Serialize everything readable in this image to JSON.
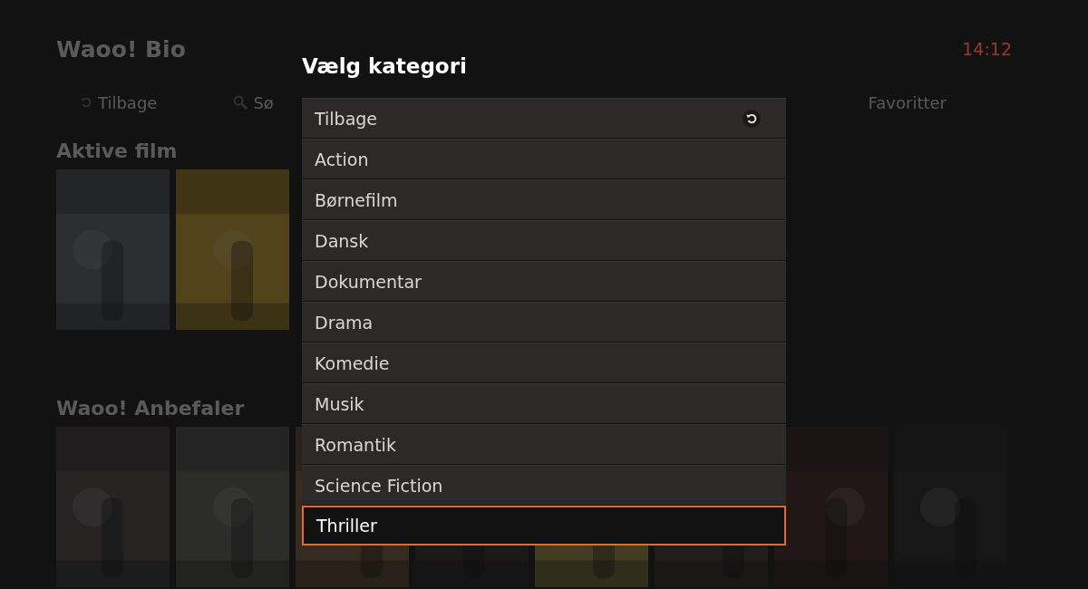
{
  "background": {
    "title": "Waoo! Bio",
    "clock": "14:12",
    "nav": [
      {
        "kind": "back",
        "label": "Tilbage"
      },
      {
        "kind": "search",
        "label": "Sø"
      },
      {
        "kind": "plain",
        "label": "Favoritter"
      }
    ],
    "sections": [
      {
        "title": "Aktive film"
      },
      {
        "title": "Waoo! Anbefaler"
      }
    ]
  },
  "dialog": {
    "title": "Vælg kategori",
    "items": [
      {
        "kind": "back",
        "label": "Tilbage",
        "selected": false
      },
      {
        "kind": "plain",
        "label": "Action",
        "selected": false
      },
      {
        "kind": "plain",
        "label": "Børnefilm",
        "selected": false
      },
      {
        "kind": "plain",
        "label": "Dansk",
        "selected": false
      },
      {
        "kind": "plain",
        "label": "Dokumentar",
        "selected": false
      },
      {
        "kind": "plain",
        "label": "Drama",
        "selected": false
      },
      {
        "kind": "plain",
        "label": "Komedie",
        "selected": false
      },
      {
        "kind": "plain",
        "label": "Musik",
        "selected": false
      },
      {
        "kind": "plain",
        "label": "Romantik",
        "selected": false
      },
      {
        "kind": "plain",
        "label": "Science Fiction",
        "selected": false
      },
      {
        "kind": "plain",
        "label": "Thriller",
        "selected": true
      }
    ]
  }
}
